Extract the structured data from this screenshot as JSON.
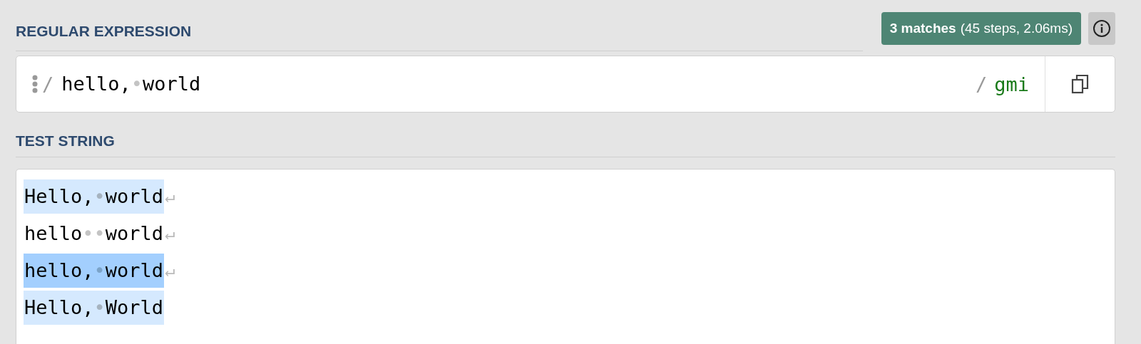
{
  "regex_section": {
    "title": "REGULAR EXPRESSION",
    "result": {
      "count": "3 matches",
      "details": "(45 steps, 2.06ms)"
    },
    "delimiter_open": "/",
    "pattern": "hello,•world",
    "delimiter_close": "/",
    "flags": "gmi"
  },
  "test_section": {
    "title": "TEST STRING",
    "lines": [
      {
        "text": "Hello,•world",
        "matched": true,
        "selected": false,
        "end_mark": "↵"
      },
      {
        "text": "hello••world",
        "matched": false,
        "selected": false,
        "end_mark": "↵"
      },
      {
        "text": "hello,•world",
        "matched": true,
        "selected": true,
        "end_mark": "↵"
      },
      {
        "text": "Hello,•World",
        "matched": true,
        "selected": false
      }
    ]
  }
}
